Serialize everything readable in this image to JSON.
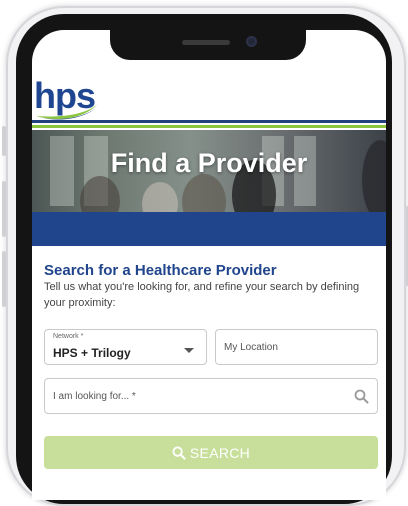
{
  "logo": {
    "text": "hps"
  },
  "hero": {
    "title": "Find a Provider"
  },
  "form": {
    "title": "Search for a Healthcare Provider",
    "description": "Tell us what you're looking for, and refine your search by defining your proximity:",
    "network": {
      "label": "Network *",
      "value": "HPS + Trilogy"
    },
    "location": {
      "placeholder": "My Location"
    },
    "looking_for": {
      "placeholder": "I am looking for... *"
    },
    "search_button": {
      "label": "SEARCH"
    }
  },
  "colors": {
    "brand_blue": "#21458c",
    "brand_green": "#8cc63f",
    "button_green": "#c7df9a"
  },
  "icons": [
    "chevron-down-icon",
    "search-icon"
  ]
}
